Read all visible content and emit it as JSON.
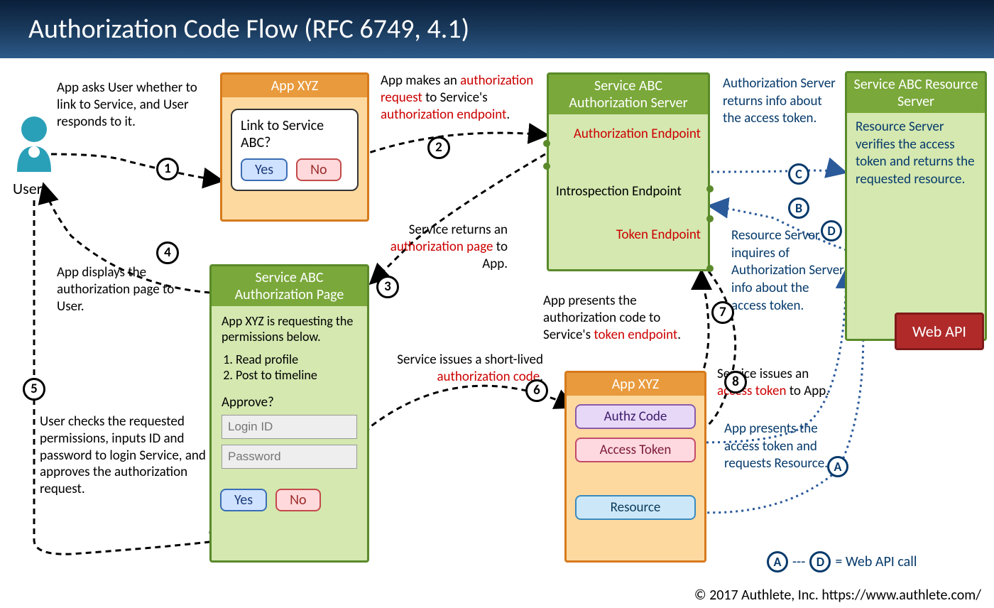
{
  "header": {
    "title": "Authorization Code Flow   (RFC 6749, 4.1)"
  },
  "user": {
    "label": "User"
  },
  "app_xyz_1": {
    "title": "App XYZ",
    "question": "Link to Service ABC?",
    "yes": "Yes",
    "no": "No"
  },
  "auth_server": {
    "title": "Service ABC Authorization Server",
    "ep_auth": "Authorization Endpoint",
    "ep_introspect": "Introspection Endpoint",
    "ep_token": "Token Endpoint"
  },
  "res_server": {
    "title": "Service ABC Resource Server",
    "body": "Resource Server verifies the access token and returns the requested resource."
  },
  "auth_page": {
    "title": "Service ABC Authorization Page",
    "intro": "App XYZ is requesting the permissions below.",
    "perm1": "Read profile",
    "perm2": "Post to timeline",
    "approve": "Approve?",
    "login_ph": "Login ID",
    "pass_ph": "Password",
    "yes": "Yes",
    "no": "No"
  },
  "app_xyz_2": {
    "title": "App XYZ",
    "authz": "Authz Code",
    "access": "Access Token",
    "resource": "Resource"
  },
  "webapi": {
    "label": "Web API"
  },
  "notes": {
    "n1": "App asks User whether to link to Service, and User responds to it.",
    "n2a": "App makes an ",
    "n2b": "authorization request",
    "n2c": " to Service's ",
    "n2d": "authorization endpoint",
    "n2e": ".",
    "n3a": "Service returns an ",
    "n3b": "authorization page",
    "n3c": " to App.",
    "n4": "App displays the authorization page to User.",
    "n5": "User checks the requested permissions, inputs ID and password to login Service, and approves the authorization request.",
    "n6a": "Service issues a short-lived ",
    "n6b": "authorization code",
    "n6c": ".",
    "n7a": "App presents the authorization code to Service's ",
    "n7b": "token endpoint",
    "n7c": ".",
    "n8a": "Service issues an ",
    "n8b": "access token",
    "n8c": " to App.",
    "nC": "Authorization Server returns info about the access token.",
    "nB": "Resource Server inquires of Authorization Server info about the access token.",
    "nA": "App presents the access token and requests Resource.",
    "nD": ""
  },
  "steps": {
    "s1": "1",
    "s2": "2",
    "s3": "3",
    "s4": "4",
    "s5": "5",
    "s6": "6",
    "s7": "7",
    "s8": "8",
    "A": "A",
    "B": "B",
    "C": "C",
    "D": "D"
  },
  "legend": {
    "A": "A",
    "dash": "---",
    "D": "D",
    "text": " = Web API call"
  },
  "footer": {
    "text": "© 2017 Authlete, Inc.  https://www.authlete.com/"
  }
}
